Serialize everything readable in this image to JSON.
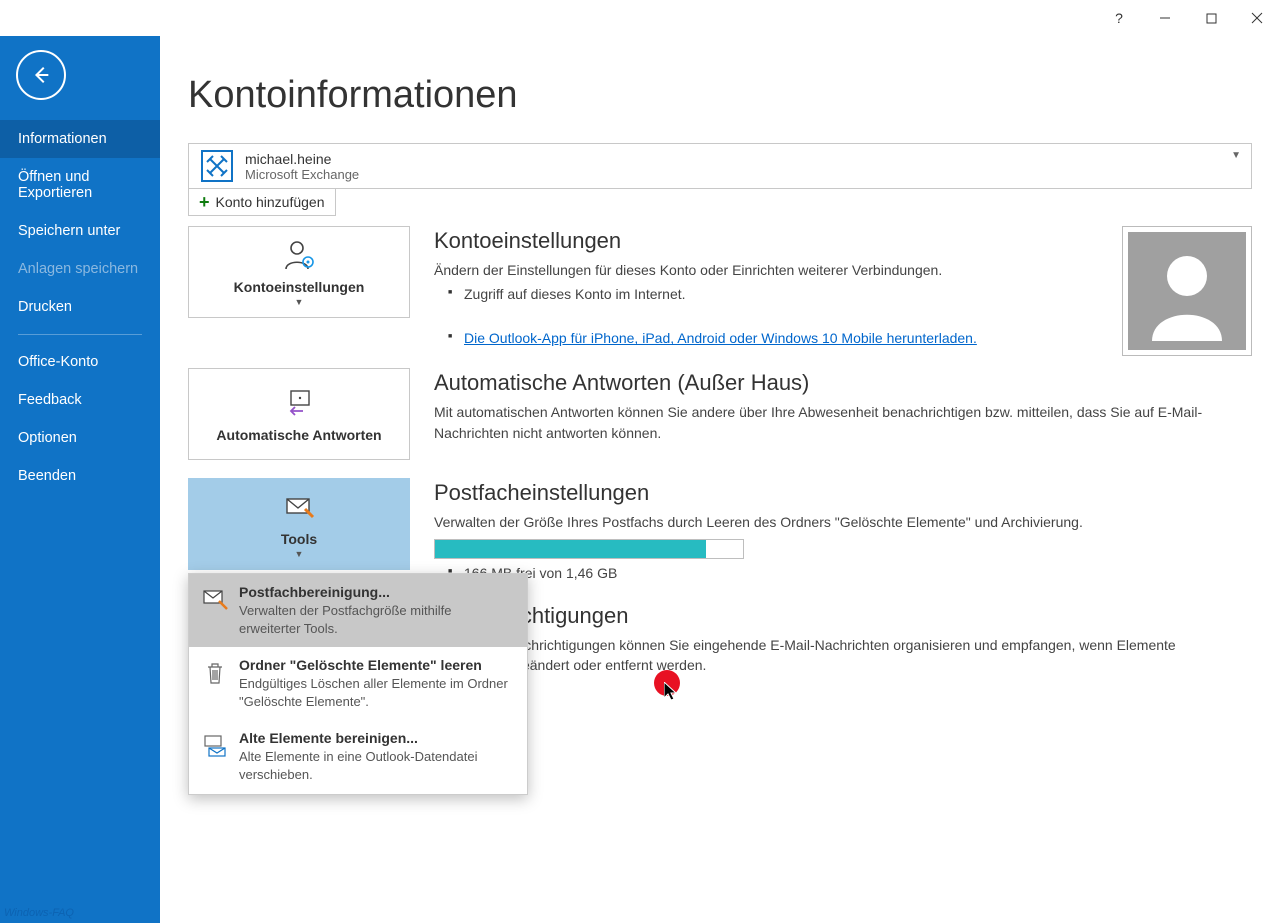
{
  "titlebar": {
    "help": "?"
  },
  "sidebar": {
    "items": [
      {
        "label": "Informationen",
        "selected": true
      },
      {
        "label": "Öffnen und Exportieren"
      },
      {
        "label": "Speichern unter"
      },
      {
        "label": "Anlagen speichern",
        "disabled": true
      },
      {
        "label": "Drucken"
      },
      {
        "label": "Office-Konto",
        "afterDivider": true
      },
      {
        "label": "Feedback"
      },
      {
        "label": "Optionen"
      },
      {
        "label": "Beenden"
      }
    ]
  },
  "page": {
    "title": "Kontoinformationen",
    "account": {
      "name": "michael.heine",
      "type": "Microsoft Exchange"
    },
    "addAccount": "Konto hinzufügen"
  },
  "sections": {
    "settings": {
      "tile": "Kontoeinstellungen",
      "title": "Kontoeinstellungen",
      "desc": "Ändern der Einstellungen für dieses Konto oder Einrichten weiterer Verbindungen.",
      "bullet1": "Zugriff auf dieses Konto im Internet.",
      "bullet2": "Die Outlook-App für iPhone, iPad, Android oder Windows 10 Mobile herunterladen."
    },
    "autoReply": {
      "tile": "Automatische Antworten",
      "title": "Automatische Antworten (Außer Haus)",
      "desc": "Mit automatischen Antworten können Sie andere über Ihre Abwesenheit benachrichtigen bzw. mitteilen, dass Sie auf E-Mail-Nachrichten nicht antworten können."
    },
    "mailbox": {
      "tile": "Tools",
      "title": "Postfacheinstellungen",
      "desc": "Verwalten der Größe Ihres Postfachs durch Leeren des Ordners \"Gelöschte Elemente\" und Archivierung.",
      "storage": "166 MB frei von 1,46 GB",
      "progressPct": 88
    },
    "rules": {
      "title": "Benachrichtigungen",
      "desc": "geln und Benachrichtigungen können Sie eingehende E-Mail-Nachrichten organisieren und empfangen, wenn Elemente hinzugefügt, geändert oder entfernt werden."
    }
  },
  "dropdown": {
    "item1": {
      "title": "Postfachbereinigung...",
      "desc": "Verwalten der Postfachgröße mithilfe erweiterter Tools."
    },
    "item2": {
      "title": "Ordner \"Gelöschte Elemente\" leeren",
      "desc": "Endgültiges Löschen aller Elemente im Ordner \"Gelöschte Elemente\"."
    },
    "item3": {
      "title": "Alte Elemente bereinigen...",
      "desc": "Alte Elemente in eine Outlook-Datendatei verschieben."
    }
  },
  "watermark": "Windows-FAQ"
}
